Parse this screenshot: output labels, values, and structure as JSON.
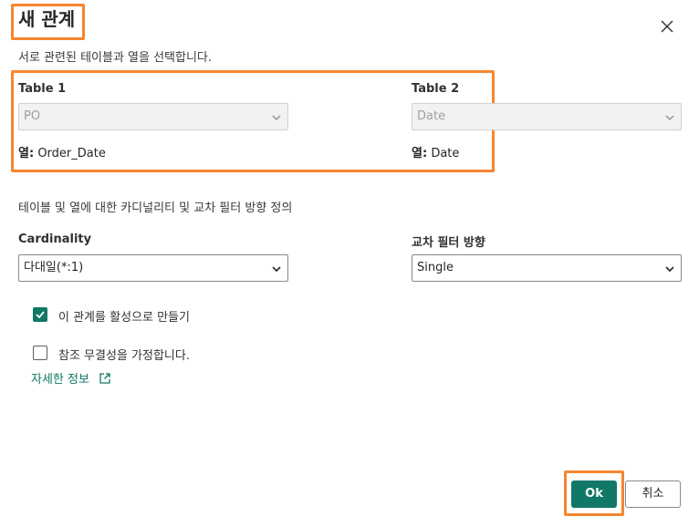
{
  "dialog": {
    "title": "새 관계",
    "subtitle": "서로 관련된 테이블과 열을 선택합니다."
  },
  "table1": {
    "label": "Table 1",
    "selected": "PO",
    "column_prefix": "열:",
    "column_value": "Order_Date"
  },
  "table2": {
    "label": "Table 2",
    "selected": "Date",
    "column_prefix": "열:",
    "column_value": "Date"
  },
  "section_text": "테이블 및 열에 대한 카디널리티 및 교차 필터 방향 정의",
  "cardinality": {
    "label": "Cardinality",
    "selected": "다대일(*:1)"
  },
  "cross_filter": {
    "label": "교차 필터 방향",
    "selected": "Single"
  },
  "options": {
    "active_label": "이 관계를 활성으로 만들기",
    "active_checked": true,
    "integrity_label": "참조 무결성을 가정합니다.",
    "integrity_checked": false
  },
  "learn_more": "자세한 정보",
  "buttons": {
    "ok": "Ok",
    "cancel": "취소"
  },
  "colors": {
    "accent": "#117865",
    "highlight": "#f7862e"
  }
}
